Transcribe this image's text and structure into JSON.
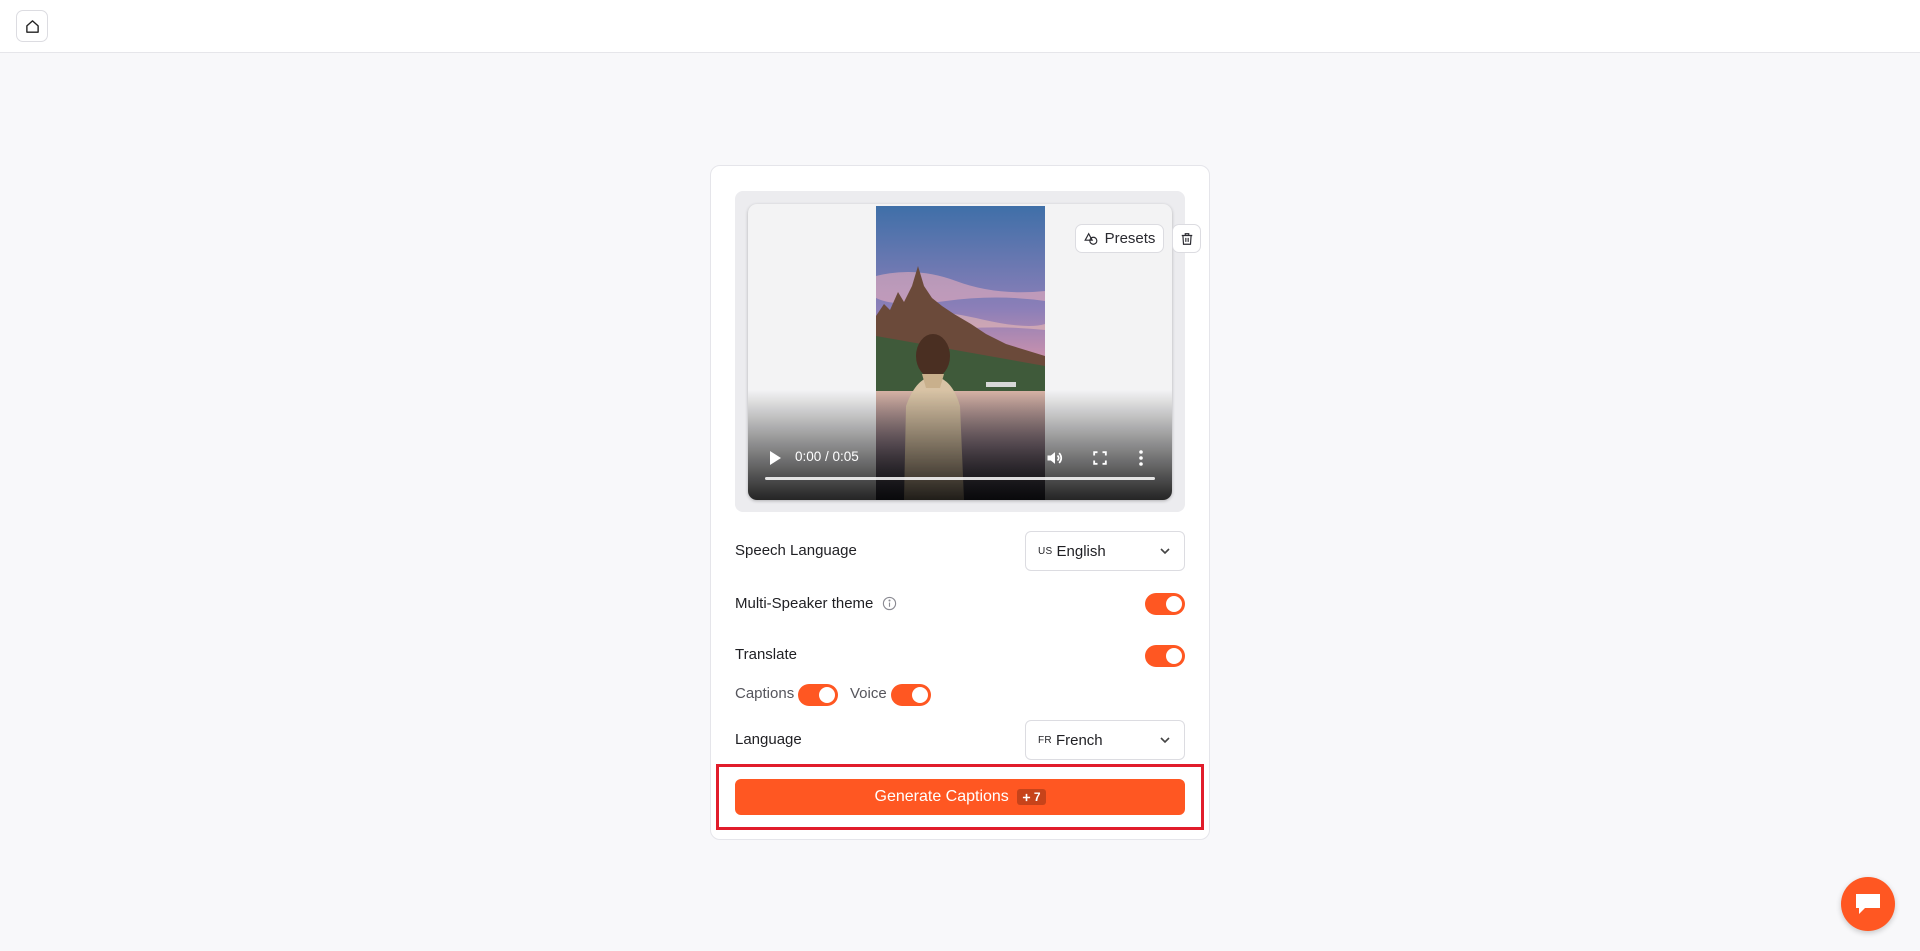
{
  "header": {
    "home_icon": "home-icon"
  },
  "video": {
    "time": "0:00 / 0:05",
    "controls": [
      "play-icon",
      "volume-icon",
      "fullscreen-icon",
      "more-vertical-icon"
    ],
    "progress": 0
  },
  "toolbar": {
    "presets_label": "Presets",
    "presets_icon": "shapes-icon",
    "delete_icon": "trash-icon"
  },
  "settings": {
    "speech_language": {
      "label": "Speech Language",
      "code": "US",
      "value": "English"
    },
    "multi_speaker": {
      "label": "Multi-Speaker theme",
      "enabled": true
    },
    "translate": {
      "label": "Translate",
      "enabled": true,
      "captions_label": "Captions",
      "captions_enabled": true,
      "voice_label": "Voice",
      "voice_enabled": true
    },
    "language": {
      "label": "Language",
      "code": "FR",
      "value": "French"
    }
  },
  "generate": {
    "label": "Generate Captions",
    "credit": "7"
  },
  "colors": {
    "accent": "#ff5722",
    "highlight": "#e11d2b",
    "background": "#f8f8fa"
  }
}
